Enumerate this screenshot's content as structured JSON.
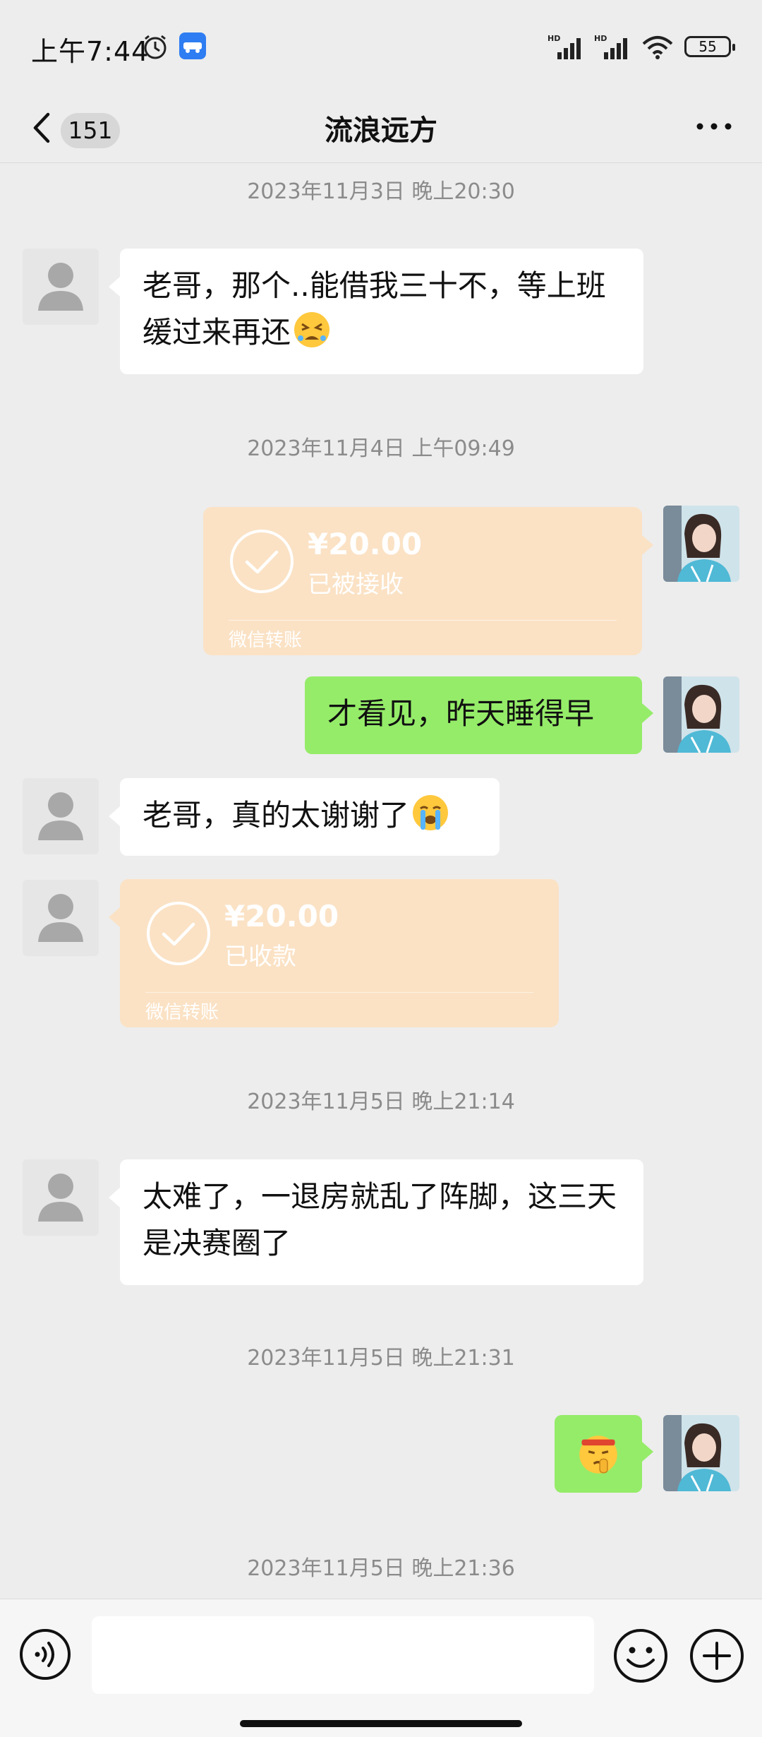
{
  "status_bar": {
    "time": "上午7:44",
    "battery": "55",
    "signal_label": "HD"
  },
  "header": {
    "unread_count": "151",
    "title": "流浪远方"
  },
  "messages": {
    "ts1": "2023年11月3日 晚上20:30",
    "m1_text": "老哥，那个..能借我三十不，等上班缓过来再还",
    "ts2": "2023年11月4日 上午09:49",
    "t1_amount": "¥20.00",
    "t1_status": "已被接收",
    "t1_footer": "微信转账",
    "m2_text": "才看见，昨天睡得早",
    "m3_text": "老哥，真的太谢谢了",
    "t2_amount": "¥20.00",
    "t2_status": "已收款",
    "t2_footer": "微信转账",
    "ts3": "2023年11月5日 晚上21:14",
    "m4_text": "太难了，一退房就乱了阵脚，这三天是决赛圈了",
    "ts4": "2023年11月5日 晚上21:31",
    "ts5": "2023年11月5日 晚上21:36"
  },
  "input": {
    "placeholder": ""
  },
  "colors": {
    "background": "#ededed",
    "bubble_self": "#95ec69",
    "bubble_other": "#ffffff",
    "transfer": "#fbe2c5"
  },
  "icons": {
    "back": "chevron-left-icon",
    "more": "more-dots-icon",
    "voice": "voice-icon",
    "emoji": "emoji-icon",
    "plus": "plus-icon"
  }
}
